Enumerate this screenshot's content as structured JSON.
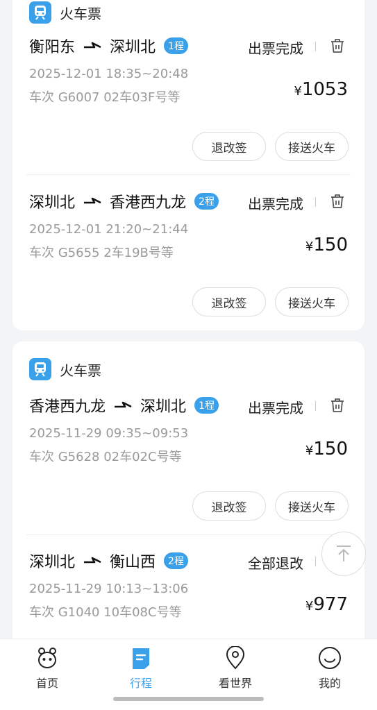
{
  "cards": [
    {
      "header_label": "火车票",
      "segments": [
        {
          "from": "衡阳东",
          "to": "深圳北",
          "leg": "1程",
          "status": "出票完成",
          "time": "2025-12-01 18:35~20:48",
          "train": "车次 G6007  02车03F号等",
          "currency": "¥",
          "price": "1053",
          "btn_change": "退改签",
          "btn_pickup": "接送火车"
        },
        {
          "from": "深圳北",
          "to": "香港西九龙",
          "leg": "2程",
          "status": "出票完成",
          "time": "2025-12-01 21:20~21:44",
          "train": "车次 G5655  2车19B号等",
          "currency": "¥",
          "price": "150",
          "btn_change": "退改签",
          "btn_pickup": "接送火车"
        }
      ]
    },
    {
      "header_label": "火车票",
      "segments": [
        {
          "from": "香港西九龙",
          "to": "深圳北",
          "leg": "1程",
          "status": "出票完成",
          "time": "2025-11-29 09:35~09:53",
          "train": "车次 G5628  02车02C号等",
          "currency": "¥",
          "price": "150",
          "btn_change": "退改签",
          "btn_pickup": "接送火车"
        },
        {
          "from": "深圳北",
          "to": "衡山西",
          "leg": "2程",
          "status": "全部退改",
          "time": "2025-11-29 10:13~13:06",
          "train": "车次 G1040  10车08C号等",
          "currency": "¥",
          "price": "977"
        }
      ]
    }
  ],
  "tabbar": {
    "items": [
      {
        "label": "首页",
        "icon": "home-mascot-icon"
      },
      {
        "label": "行程",
        "icon": "itinerary-icon"
      },
      {
        "label": "看世界",
        "icon": "location-pin-icon"
      },
      {
        "label": "我的",
        "icon": "smiley-icon"
      }
    ],
    "active": "行程"
  },
  "colors": {
    "accent": "#3aa0ea",
    "text": "#222222",
    "muted": "#9a9a9a",
    "background": "#f3f4f6"
  }
}
